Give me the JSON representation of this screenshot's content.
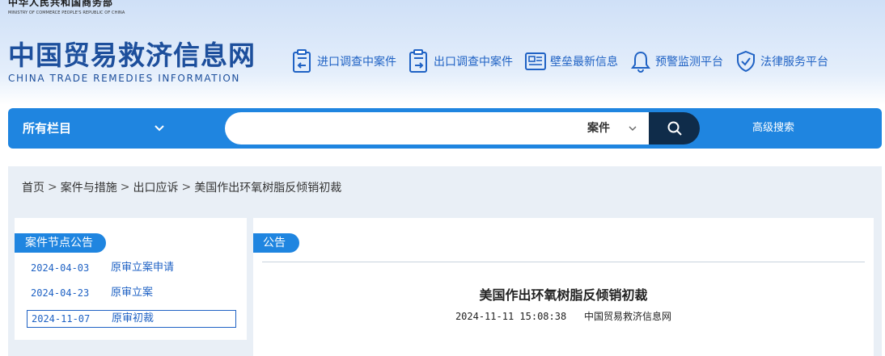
{
  "header": {
    "ministry_cn": "中华人民共和国商务部",
    "ministry_en": "MINISTRY OF COMMERCE PEOPLE'S REPUBLIC OF CHINA",
    "brand_cn": "中国贸易救济信息网",
    "brand_en": "CHINA TRADE REMEDIES INFORMATION",
    "nav": [
      {
        "label": "进口调查中案件",
        "icon": "import-case-icon"
      },
      {
        "label": "出口调查中案件",
        "icon": "export-case-icon"
      },
      {
        "label": "壁垒最新信息",
        "icon": "news-icon"
      },
      {
        "label": "预警监测平台",
        "icon": "bell-icon"
      },
      {
        "label": "法律服务平台",
        "icon": "shield-check-icon"
      }
    ],
    "accent": "#1f85e0",
    "brand_color": "#1d4f9c"
  },
  "search": {
    "scope_label": "所有栏目",
    "query": "",
    "type_label": "案件",
    "advanced_label": "高级搜索"
  },
  "breadcrumb": {
    "items": [
      "首页",
      "案件与措施",
      "出口应诉",
      "美国作出环氧树脂反倾销初裁"
    ]
  },
  "left_panel": {
    "title": "案件节点公告",
    "nodes": [
      {
        "date": "2024-04-03",
        "label": "原审立案申请"
      },
      {
        "date": "2024-04-23",
        "label": "原审立案"
      },
      {
        "date": "2024-11-07",
        "label": "原审初裁"
      }
    ]
  },
  "article": {
    "tab": "公告",
    "title": "美国作出环氧树脂反倾销初裁",
    "timestamp": "2024-11-11 15:08:38",
    "source": "中国贸易救济信息网"
  }
}
